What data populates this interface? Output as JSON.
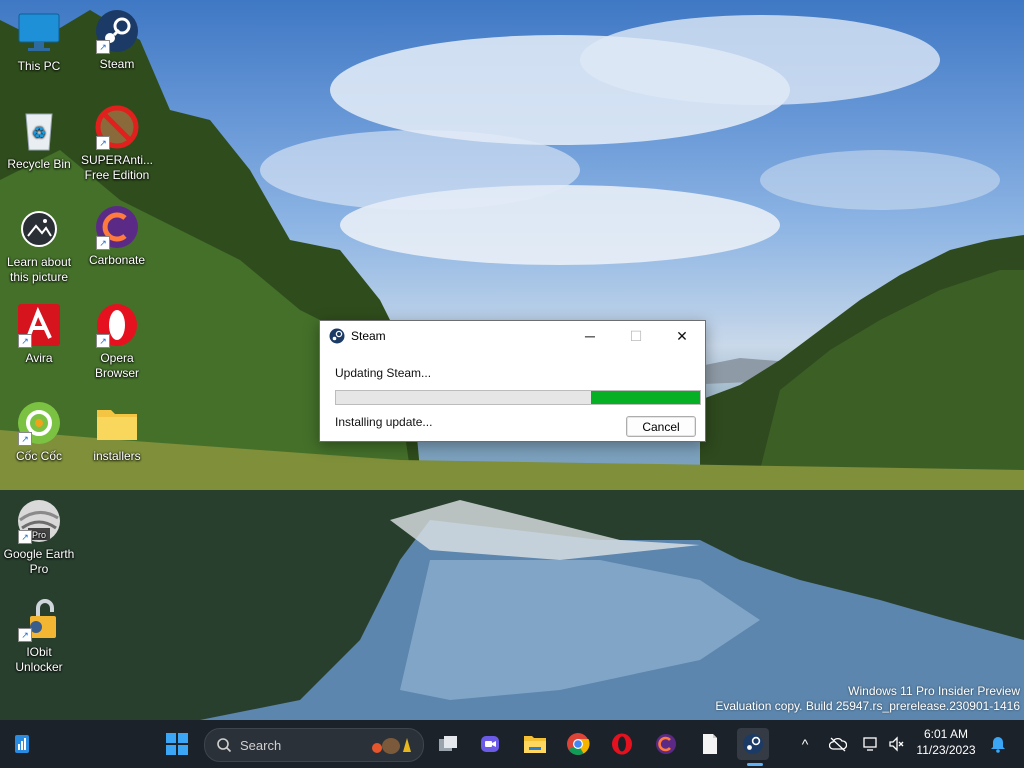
{
  "desktop": {
    "icons": [
      {
        "label_line1": "This PC",
        "label_line2": "",
        "icon": "this-pc-icon"
      },
      {
        "label_line1": "Steam",
        "label_line2": "",
        "icon": "steam-icon"
      },
      {
        "label_line1": "Recycle Bin",
        "label_line2": "",
        "icon": "recycle-bin-icon"
      },
      {
        "label_line1": "SUPERAnti...",
        "label_line2": "Free Edition",
        "icon": "superantispyware-icon"
      },
      {
        "label_line1": "Learn about",
        "label_line2": "this picture",
        "icon": "learn-about-picture-icon"
      },
      {
        "label_line1": "Carbonate",
        "label_line2": "",
        "icon": "carbonate-icon"
      },
      {
        "label_line1": "Avira",
        "label_line2": "",
        "icon": "avira-icon"
      },
      {
        "label_line1": "Opera",
        "label_line2": "Browser",
        "icon": "opera-icon"
      },
      {
        "label_line1": "Cốc Cốc",
        "label_line2": "",
        "icon": "coc-coc-icon"
      },
      {
        "label_line1": "installers",
        "label_line2": "",
        "icon": "folder-icon"
      },
      {
        "label_line1": "Google Earth",
        "label_line2": "Pro",
        "icon": "google-earth-pro-icon"
      },
      {
        "label_line1": "IObit",
        "label_line2": "Unlocker",
        "icon": "iobit-unlocker-icon"
      }
    ],
    "watermark": {
      "line1": "Windows 11 Pro Insider Preview",
      "line2": "Evaluation copy. Build 25947.rs_prerelease.230901-1416"
    }
  },
  "dialog": {
    "title": "Steam",
    "status": "Updating Steam...",
    "substatus": "Installing update...",
    "progress_fraction": 0.3,
    "progress_color": "#06b025",
    "cancel_label": "Cancel",
    "minimize_glyph": "─",
    "maximize_glyph": "☐",
    "close_glyph": "✕"
  },
  "taskbar": {
    "search_placeholder": "Search",
    "items": [
      "widgets-icon",
      "start-icon",
      "task-view-icon",
      "meet-icon",
      "file-explorer-icon",
      "chrome-icon",
      "opera-icon",
      "coc-coc-icon",
      "notepad-icon",
      "steam-icon"
    ],
    "tray": {
      "chevron": "^",
      "time": "6:01 AM",
      "date": "11/23/2023"
    }
  },
  "colors": {
    "taskbar_bg": "#1c2229",
    "accent": "#0a84ff"
  }
}
